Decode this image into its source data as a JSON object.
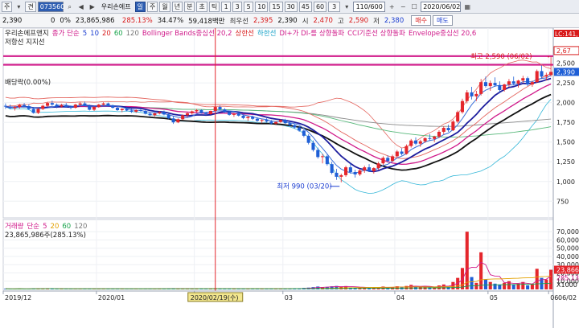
{
  "toolbar": {
    "labels": [
      "주",
      "견"
    ],
    "code": "073560",
    "name": "우리손에프",
    "periods": [
      "일",
      "주",
      "월",
      "년",
      "분",
      "초",
      "틱"
    ],
    "active_period": "일",
    "minutes": [
      "1",
      "3",
      "5",
      "10",
      "15",
      "30",
      "45",
      "60",
      "3"
    ],
    "page": "110/600",
    "date": "2020/06/02"
  },
  "quote": {
    "items": [
      {
        "text": "2,390",
        "color": "normal"
      },
      {
        "text": "0",
        "color": "normal"
      },
      {
        "text": "0%",
        "color": "normal"
      },
      {
        "text": "23,865,986",
        "color": "normal"
      },
      {
        "text": "285.13%",
        "color": "red"
      },
      {
        "text": "34.47%",
        "color": "normal"
      },
      {
        "text": "59,418백만",
        "color": "normal"
      },
      {
        "text": "최우선",
        "color": "label"
      },
      {
        "text": "2,395",
        "color": "red"
      },
      {
        "text": "2,390",
        "color": "normal"
      },
      {
        "text": "시",
        "color": "label"
      },
      {
        "text": "2,470",
        "color": "red"
      },
      {
        "text": "고",
        "color": "label"
      },
      {
        "text": "2,590",
        "color": "red"
      },
      {
        "text": "저",
        "color": "label"
      },
      {
        "text": "2,380",
        "color": "blue"
      }
    ],
    "buy_label": "매수",
    "sell_label": "매도"
  },
  "price_panel": {
    "indicators": [
      {
        "text": "우리손에프앤지",
        "color": "#222222"
      },
      {
        "text": "종가 단순",
        "color": "#d01a8a"
      },
      {
        "text": "5",
        "color": "#1d3fd1"
      },
      {
        "text": "10",
        "color": "#1d3fd1"
      },
      {
        "text": "20",
        "color": "#d81b1b"
      },
      {
        "text": "60",
        "color": "#17a34a"
      },
      {
        "text": "120",
        "color": "#777777"
      },
      {
        "text": "Bollinger Bands중심선 20,2",
        "color": "#d01a8a"
      },
      {
        "text": "상한선",
        "color": "#d81b1b"
      },
      {
        "text": "하한선",
        "color": "#1aa3c9"
      },
      {
        "text": "DI+가 DI-를 상향돌파",
        "color": "#d01a8a"
      },
      {
        "text": "CCI기준선 상향돌파",
        "color": "#d01a8a"
      },
      {
        "text": "Envelope중심선 20,6",
        "color": "#d01a8a"
      }
    ],
    "sub_label": "저항선  지지선",
    "left_label": "배당락(0.00%)",
    "high_label": "최고 2,590 (06/02)",
    "low_label": "최저 990 (03/20)",
    "lc_label": "LC:141,",
    "y_ticks": [
      "2,500",
      "2,250",
      "2,000",
      "1,750",
      "1,500",
      "1,250",
      "1,000",
      "750"
    ],
    "current_price": "2,390",
    "upper_price": "2,67"
  },
  "volume_panel": {
    "legend": [
      {
        "text": "거래량",
        "color": "#d01a8a"
      },
      {
        "text": "단순",
        "color": "#d01a8a"
      },
      {
        "text": "5",
        "color": "#d01a8a"
      },
      {
        "text": "20",
        "color": "#e3a100"
      },
      {
        "text": "60",
        "color": "#17a34a"
      },
      {
        "text": "120",
        "color": "#777777"
      }
    ],
    "info": "23,865,986주(285.13%)",
    "y_ticks": [
      "70,000",
      "60,000",
      "50,000",
      "40,000",
      "30,000",
      "20,000",
      "10,000"
    ],
    "current_volume": "23,866",
    "secondary_value": "285,13",
    "unit_label": "X1000"
  },
  "x_axis": {
    "labels": [
      "2019/12",
      "2020/01",
      "02",
      "03",
      "04",
      "05",
      "06"
    ],
    "cursor_date": "2020/02/19(수)",
    "right_label": "06/02"
  },
  "chart_data": {
    "type": "candlestick",
    "price_ylim": [
      600,
      2700
    ],
    "volume_ylim": [
      0,
      78000
    ],
    "cursor_index": 45,
    "resistance": [
      2590,
      2480
    ],
    "ohlc": [
      [
        1960,
        1990,
        1920,
        1950
      ],
      [
        1950,
        1975,
        1915,
        1930
      ],
      [
        1930,
        1960,
        1900,
        1945
      ],
      [
        1945,
        1985,
        1925,
        1970
      ],
      [
        1970,
        1995,
        1940,
        1955
      ],
      [
        1955,
        1980,
        1905,
        1920
      ],
      [
        1920,
        1945,
        1860,
        1870
      ],
      [
        1870,
        1935,
        1855,
        1920
      ],
      [
        1920,
        1975,
        1905,
        1960
      ],
      [
        1960,
        2010,
        1945,
        1995
      ],
      [
        1995,
        2025,
        1960,
        1975
      ],
      [
        1975,
        1990,
        1930,
        1950
      ],
      [
        1950,
        1985,
        1935,
        1970
      ],
      [
        1970,
        1995,
        1935,
        1945
      ],
      [
        1945,
        1965,
        1915,
        1935
      ],
      [
        1935,
        1985,
        1925,
        1975
      ],
      [
        1975,
        2010,
        1955,
        1990
      ],
      [
        1990,
        2015,
        1950,
        1960
      ],
      [
        1960,
        1975,
        1900,
        1910
      ],
      [
        1910,
        1955,
        1895,
        1945
      ],
      [
        1945,
        1985,
        1935,
        1975
      ],
      [
        1975,
        2005,
        1960,
        1990
      ],
      [
        1990,
        2000,
        1950,
        1960
      ],
      [
        1960,
        1975,
        1925,
        1935
      ],
      [
        1935,
        1950,
        1895,
        1905
      ],
      [
        1905,
        1930,
        1880,
        1920
      ],
      [
        1920,
        1940,
        1890,
        1900
      ],
      [
        1900,
        1920,
        1870,
        1885
      ],
      [
        1885,
        1915,
        1870,
        1905
      ],
      [
        1905,
        1925,
        1885,
        1895
      ],
      [
        1895,
        1905,
        1850,
        1860
      ],
      [
        1860,
        1880,
        1830,
        1840
      ],
      [
        1840,
        1870,
        1825,
        1865
      ],
      [
        1865,
        1895,
        1850,
        1880
      ],
      [
        1880,
        1900,
        1840,
        1850
      ],
      [
        1850,
        1865,
        1790,
        1800
      ],
      [
        1800,
        1830,
        1730,
        1750
      ],
      [
        1750,
        1800,
        1740,
        1790
      ],
      [
        1790,
        1850,
        1780,
        1840
      ],
      [
        1840,
        1880,
        1815,
        1865
      ],
      [
        1865,
        1900,
        1845,
        1890
      ],
      [
        1890,
        1920,
        1875,
        1905
      ],
      [
        1905,
        1915,
        1860,
        1870
      ],
      [
        1870,
        1885,
        1840,
        1855
      ],
      [
        1855,
        1900,
        1845,
        1895
      ],
      [
        1895,
        1960,
        1885,
        1945
      ],
      [
        1945,
        1965,
        1905,
        1915
      ],
      [
        1915,
        1930,
        1870,
        1880
      ],
      [
        1880,
        1890,
        1835,
        1845
      ],
      [
        1845,
        1870,
        1820,
        1860
      ],
      [
        1860,
        1880,
        1825,
        1835
      ],
      [
        1835,
        1850,
        1790,
        1805
      ],
      [
        1805,
        1830,
        1770,
        1820
      ],
      [
        1820,
        1835,
        1780,
        1795
      ],
      [
        1795,
        1815,
        1755,
        1770
      ],
      [
        1770,
        1790,
        1740,
        1780
      ],
      [
        1780,
        1800,
        1750,
        1760
      ],
      [
        1760,
        1780,
        1720,
        1735
      ],
      [
        1735,
        1765,
        1720,
        1755
      ],
      [
        1755,
        1790,
        1745,
        1780
      ],
      [
        1780,
        1795,
        1730,
        1740
      ],
      [
        1740,
        1760,
        1700,
        1715
      ],
      [
        1715,
        1730,
        1670,
        1685
      ],
      [
        1685,
        1700,
        1630,
        1645
      ],
      [
        1645,
        1660,
        1560,
        1580
      ],
      [
        1580,
        1600,
        1470,
        1490
      ],
      [
        1490,
        1520,
        1380,
        1400
      ],
      [
        1400,
        1430,
        1290,
        1310
      ],
      [
        1310,
        1350,
        1230,
        1320
      ],
      [
        1320,
        1340,
        1200,
        1220
      ],
      [
        1220,
        1250,
        1090,
        1110
      ],
      [
        1110,
        1160,
        1020,
        1060
      ],
      [
        1060,
        1100,
        990,
        1080
      ],
      [
        1080,
        1200,
        1060,
        1180
      ],
      [
        1180,
        1230,
        1100,
        1120
      ],
      [
        1120,
        1150,
        1050,
        1090
      ],
      [
        1090,
        1160,
        1070,
        1140
      ],
      [
        1140,
        1200,
        1110,
        1180
      ],
      [
        1180,
        1220,
        1120,
        1130
      ],
      [
        1130,
        1180,
        1100,
        1170
      ],
      [
        1170,
        1250,
        1150,
        1230
      ],
      [
        1230,
        1320,
        1210,
        1300
      ],
      [
        1300,
        1330,
        1240,
        1260
      ],
      [
        1260,
        1340,
        1250,
        1320
      ],
      [
        1320,
        1400,
        1300,
        1380
      ],
      [
        1380,
        1420,
        1330,
        1350
      ],
      [
        1350,
        1470,
        1340,
        1450
      ],
      [
        1450,
        1540,
        1430,
        1520
      ],
      [
        1520,
        1560,
        1460,
        1480
      ],
      [
        1480,
        1530,
        1440,
        1510
      ],
      [
        1510,
        1560,
        1490,
        1550
      ],
      [
        1550,
        1600,
        1520,
        1540
      ],
      [
        1540,
        1580,
        1500,
        1570
      ],
      [
        1570,
        1650,
        1550,
        1630
      ],
      [
        1630,
        1700,
        1600,
        1680
      ],
      [
        1680,
        1720,
        1630,
        1650
      ],
      [
        1650,
        1780,
        1640,
        1760
      ],
      [
        1760,
        1900,
        1740,
        1880
      ],
      [
        1880,
        2050,
        1860,
        2020
      ],
      [
        2020,
        2160,
        1990,
        2130
      ],
      [
        2130,
        2200,
        2040,
        2080
      ],
      [
        2080,
        2150,
        2020,
        2110
      ],
      [
        2110,
        2300,
        2090,
        2260
      ],
      [
        2260,
        2330,
        2190,
        2210
      ],
      [
        2210,
        2280,
        2150,
        2250
      ],
      [
        2250,
        2320,
        2200,
        2220
      ],
      [
        2220,
        2270,
        2130,
        2160
      ],
      [
        2160,
        2240,
        2140,
        2230
      ],
      [
        2230,
        2300,
        2200,
        2270
      ],
      [
        2270,
        2330,
        2220,
        2240
      ],
      [
        2240,
        2290,
        2190,
        2280
      ],
      [
        2280,
        2340,
        2250,
        2310
      ],
      [
        2310,
        2330,
        2210,
        2230
      ],
      [
        2230,
        2280,
        2200,
        2260
      ],
      [
        2260,
        2420,
        2250,
        2400
      ],
      [
        2400,
        2470,
        2300,
        2330
      ],
      [
        2330,
        2380,
        2280,
        2350
      ],
      [
        2350,
        2590,
        2330,
        2390
      ]
    ],
    "volume": [
      800,
      600,
      700,
      900,
      650,
      700,
      1100,
      800,
      900,
      1200,
      800,
      600,
      650,
      700,
      600,
      800,
      900,
      700,
      900,
      750,
      800,
      850,
      600,
      700,
      900,
      650,
      700,
      700,
      650,
      600,
      900,
      750,
      700,
      800,
      750,
      1200,
      1500,
      900,
      1000,
      900,
      800,
      900,
      800,
      700,
      1000,
      1500,
      900,
      800,
      800,
      700,
      800,
      900,
      800,
      900,
      800,
      700,
      700,
      900,
      700,
      800,
      800,
      900,
      1000,
      1200,
      1800,
      2200,
      2800,
      3500,
      2600,
      3000,
      3800,
      4200,
      3200,
      4000,
      2500,
      2200,
      2400,
      2100,
      2000,
      1900,
      2400,
      3500,
      2300,
      2600,
      3800,
      2400,
      4200,
      5500,
      3600,
      3000,
      3400,
      2900,
      2600,
      4800,
      6000,
      3500,
      9000,
      14000,
      26000,
      70000,
      15000,
      8000,
      45000,
      12000,
      9000,
      7000,
      6000,
      8000,
      10000,
      6000,
      7000,
      9000,
      5000,
      6000,
      25000,
      14000,
      12000,
      23866
    ]
  }
}
